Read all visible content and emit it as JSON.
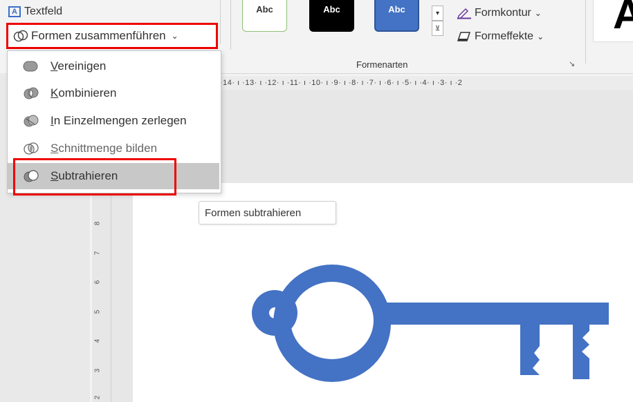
{
  "ribbon": {
    "textfeld_label": "Textfeld",
    "textfeld_icon_letter": "A",
    "merge_shapes_label": "Formen zusammenführen",
    "merge_chevron": "⌄",
    "style_thumbnails": [
      "Abc",
      "Abc",
      "Abc"
    ],
    "formkontur_label": "Formkontur",
    "formeffekte_label": "Formeffekte",
    "chevron": "⌄",
    "group_label": "Formenarten",
    "launcher_glyph": "↘",
    "wordart_letter": "A"
  },
  "ruler": {
    "horizontal_text": "·14· ı ·13· ı ·12· ı ·11· ı ·10· ı ·9· ı ·8· ı ·7· ı ·6· ı ·5· ı ·4· ı ·3· ı ·2",
    "vertical_ticks": [
      "8",
      "7",
      "6",
      "5",
      "4",
      "3",
      "2"
    ]
  },
  "dropdown": {
    "items": [
      {
        "accel": "V",
        "rest": "ereinigen",
        "icon": "union-icon"
      },
      {
        "accel": "K",
        "rest": "ombinieren",
        "icon": "combine-icon"
      },
      {
        "accel": "I",
        "rest": "n Einzelmengen zerlegen",
        "icon": "fragment-icon"
      },
      {
        "accel": "S",
        "rest": "chnittmenge bilden",
        "icon": "intersect-icon"
      },
      {
        "accel": "S",
        "rest": "ubtrahieren",
        "icon": "subtract-icon"
      }
    ]
  },
  "tooltip": {
    "text": "Formen subtrahieren"
  },
  "colors": {
    "accent_blue": "#4472c4",
    "highlight_red": "#ee0000",
    "hover_gray": "#c8c8c8"
  }
}
